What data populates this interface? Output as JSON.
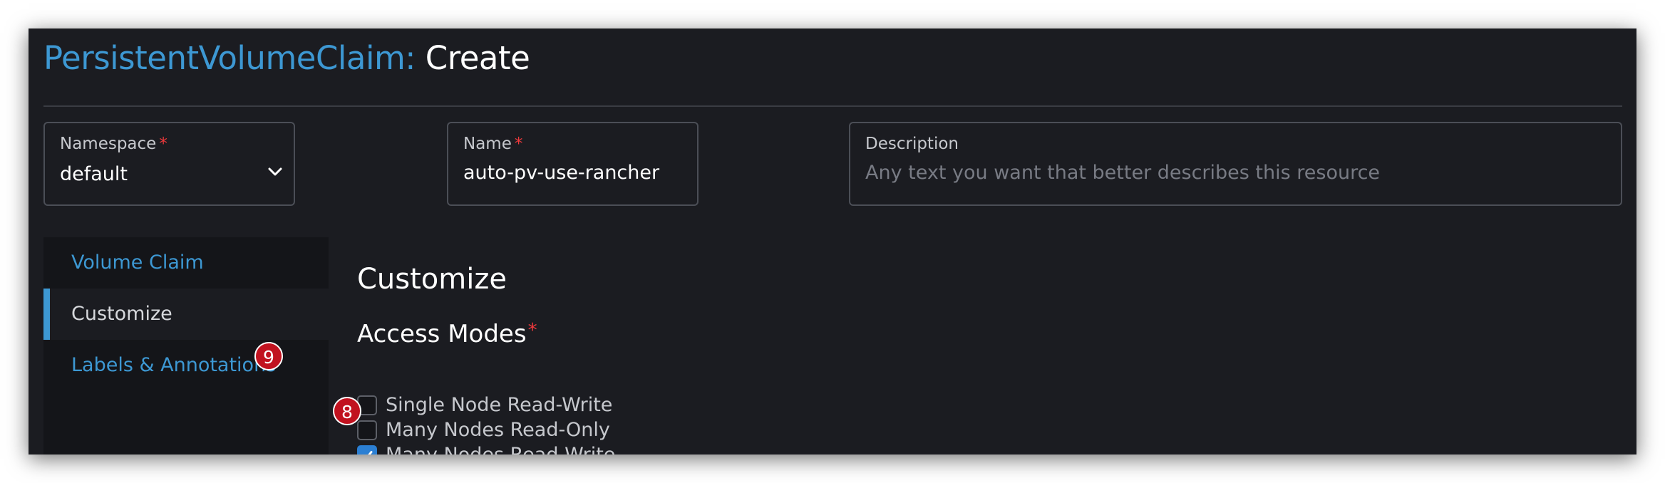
{
  "header": {
    "resource_type": "PersistentVolumeClaim:",
    "action": "Create"
  },
  "form": {
    "namespace": {
      "label": "Namespace",
      "required_mark": "*",
      "value": "default"
    },
    "name": {
      "label": "Name",
      "required_mark": "*",
      "value": "auto-pv-use-rancher"
    },
    "description": {
      "label": "Description",
      "placeholder": "Any text you want that better describes this resource"
    }
  },
  "sidebar": {
    "items": [
      {
        "label": "Volume Claim",
        "active": false
      },
      {
        "label": "Customize",
        "active": true
      },
      {
        "label": "Labels & Annotations",
        "active": false
      }
    ]
  },
  "main": {
    "section_title": "Customize",
    "access_modes": {
      "title": "Access Modes",
      "required_mark": "*",
      "options": [
        {
          "label": "Single Node Read-Write",
          "checked": false
        },
        {
          "label": "Many Nodes Read-Only",
          "checked": false
        },
        {
          "label": "Many Nodes Read-Write",
          "checked": true
        }
      ]
    }
  },
  "annotations": {
    "badge_8": "8",
    "badge_9": "9"
  },
  "colors": {
    "accent": "#3d98d3",
    "required": "#f0393c",
    "badge": "#c1121f",
    "background": "#1b1c21",
    "checkbox_checked": "#2b7fd3"
  }
}
